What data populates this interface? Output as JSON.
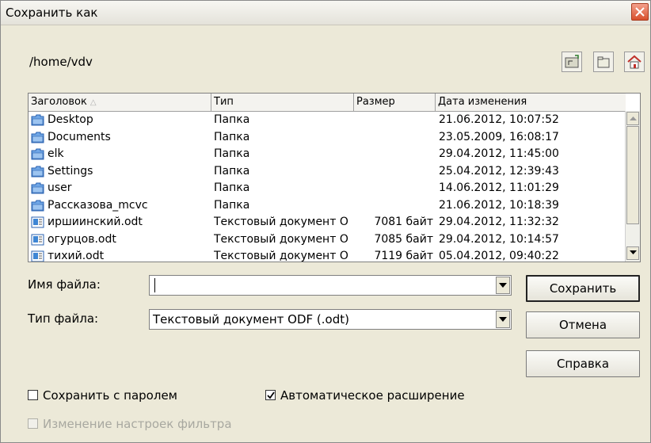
{
  "window": {
    "title": "Сохранить как"
  },
  "path": "/home/vdv",
  "toolbar": {
    "up_icon": "folder-up-icon",
    "newfolder_icon": "new-folder-icon",
    "home_icon": "home-icon"
  },
  "columns": {
    "name": "Заголовок",
    "sort_marker": "△",
    "type": "Тип",
    "size": "Размер",
    "date": "Дата изменения"
  },
  "files": [
    {
      "name": "Desktop",
      "type": "Папка",
      "size": "",
      "date": "21.06.2012, 10:07:52",
      "icon": "folder"
    },
    {
      "name": "Documents",
      "type": "Папка",
      "size": "",
      "date": "23.05.2009, 16:08:17",
      "icon": "folder"
    },
    {
      "name": "elk",
      "type": "Папка",
      "size": "",
      "date": "29.04.2012, 11:45:00",
      "icon": "folder"
    },
    {
      "name": "Settings",
      "type": "Папка",
      "size": "",
      "date": "25.04.2012, 12:39:43",
      "icon": "folder"
    },
    {
      "name": "user",
      "type": "Папка",
      "size": "",
      "date": "14.06.2012, 11:01:29",
      "icon": "folder"
    },
    {
      "name": "Рассказова_mcvc",
      "type": "Папка",
      "size": "",
      "date": "21.06.2012, 10:18:39",
      "icon": "folder"
    },
    {
      "name": "иршиинский.odt",
      "type": "Текстовый документ O",
      "size": "7081 байт",
      "date": "29.04.2012, 11:32:32",
      "icon": "document"
    },
    {
      "name": "огурцов.odt",
      "type": "Текстовый документ O",
      "size": "7085 байт",
      "date": "29.04.2012, 10:14:57",
      "icon": "document"
    },
    {
      "name": "тихий.odt",
      "type": "Текстовый документ O",
      "size": "7119 байт",
      "date": "05.04.2012, 09:40:22",
      "icon": "document"
    }
  ],
  "filename": {
    "label": "Имя файла:",
    "value": ""
  },
  "filetype": {
    "label": "Тип файла:",
    "value": "Текстовый документ ODF (.odt)"
  },
  "buttons": {
    "save": "Сохранить",
    "cancel": "Отмена",
    "help": "Справка"
  },
  "options": {
    "password": {
      "label": "Сохранить с паролем",
      "checked": false
    },
    "auto_ext": {
      "label": "Автоматическое расширение",
      "checked": true
    },
    "filter": {
      "label": "Изменение настроек фильтра",
      "checked": false,
      "disabled": true
    }
  },
  "colors": {
    "folder": "#3f86d4",
    "close_button": "#d8502c",
    "disabled_text": "#a8a8a0"
  }
}
